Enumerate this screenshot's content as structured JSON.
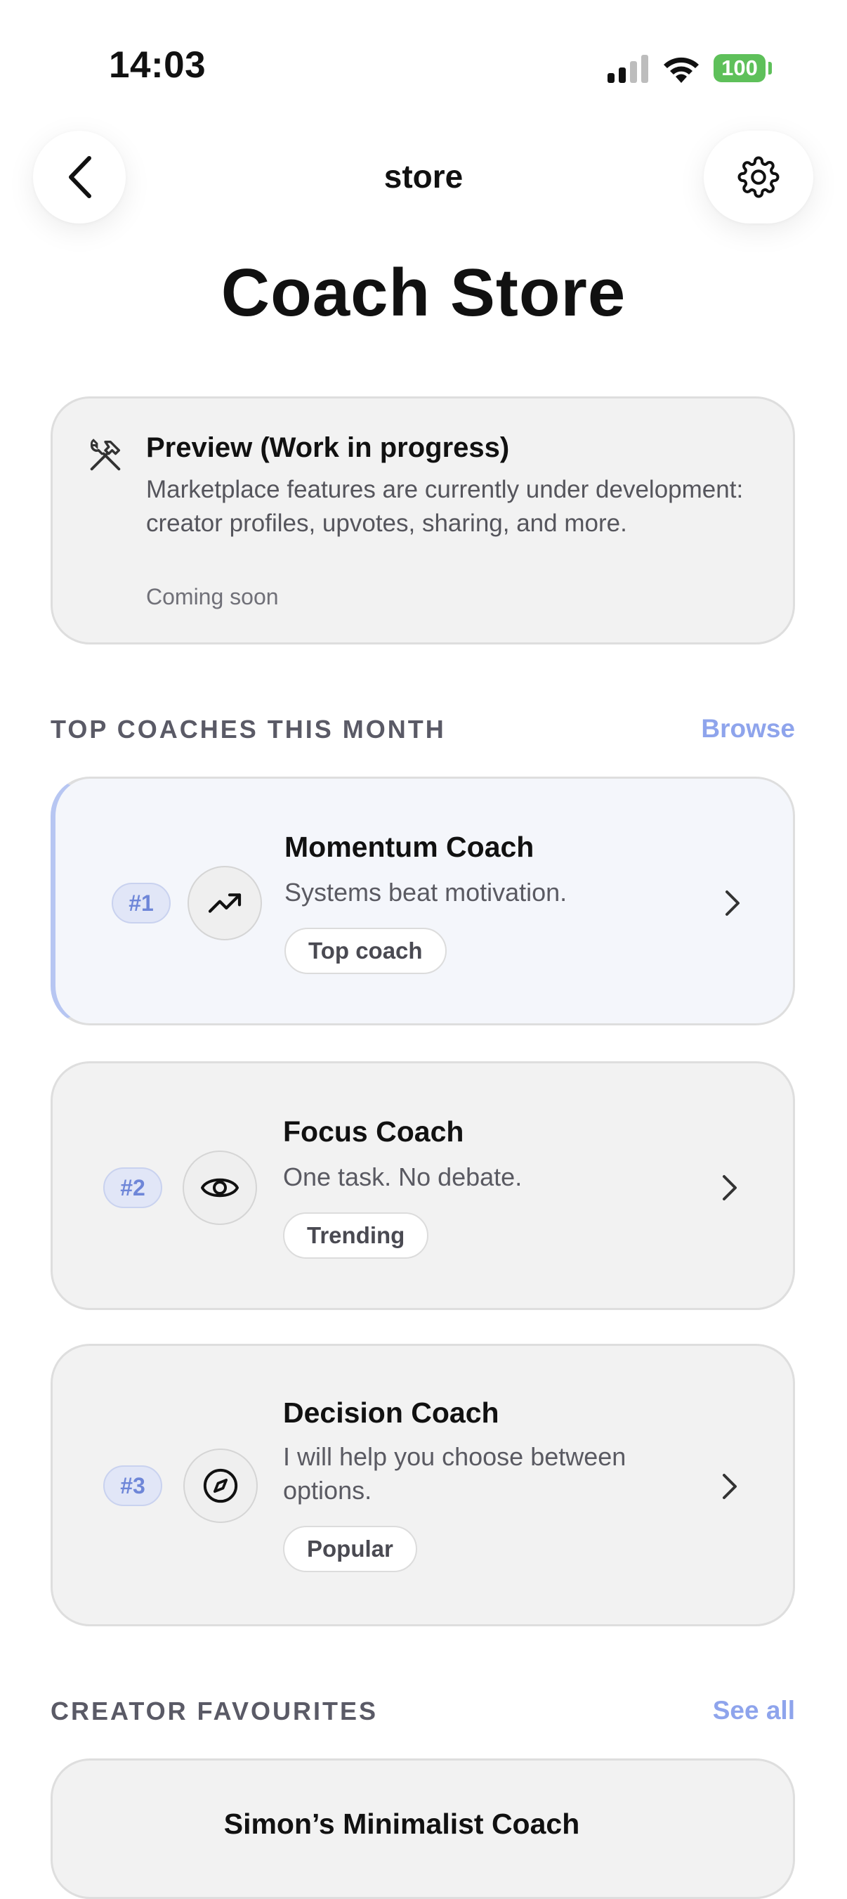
{
  "status_bar": {
    "time": "14:03",
    "battery": "100"
  },
  "nav": {
    "title": "store",
    "back_icon": "chevron-left-icon",
    "settings_icon": "gear-icon"
  },
  "page": {
    "title": "Coach Store"
  },
  "preview": {
    "icon": "tools-icon",
    "title": "Preview (Work in progress)",
    "body": "Marketplace features are currently under development: creator profiles, upvotes, sharing, and more.",
    "footer": "Coming soon"
  },
  "top_coaches": {
    "label": "TOP COACHES THIS MONTH",
    "link": "Browse",
    "items": [
      {
        "rank": "#1",
        "icon": "trending-up-icon",
        "name": "Momentum Coach",
        "tagline": "Systems beat motivation.",
        "tag": "Top coach"
      },
      {
        "rank": "#2",
        "icon": "eye-icon",
        "name": "Focus Coach",
        "tagline": "One task. No debate.",
        "tag": "Trending"
      },
      {
        "rank": "#3",
        "icon": "compass-icon",
        "name": "Decision Coach",
        "tagline": "I will help you choose between options.",
        "tag": "Popular"
      }
    ]
  },
  "creator_favourites": {
    "label": "CREATOR FAVOURITES",
    "link": "See all",
    "items": [
      {
        "name": "Simon’s Minimalist Coach"
      }
    ]
  },
  "colors": {
    "accent": "#8ea4ec",
    "battery": "#5ec05a",
    "card_bg": "#f2f2f2",
    "highlight_bg": "#f4f6fb",
    "badge_bg": "#e1e6f7"
  }
}
